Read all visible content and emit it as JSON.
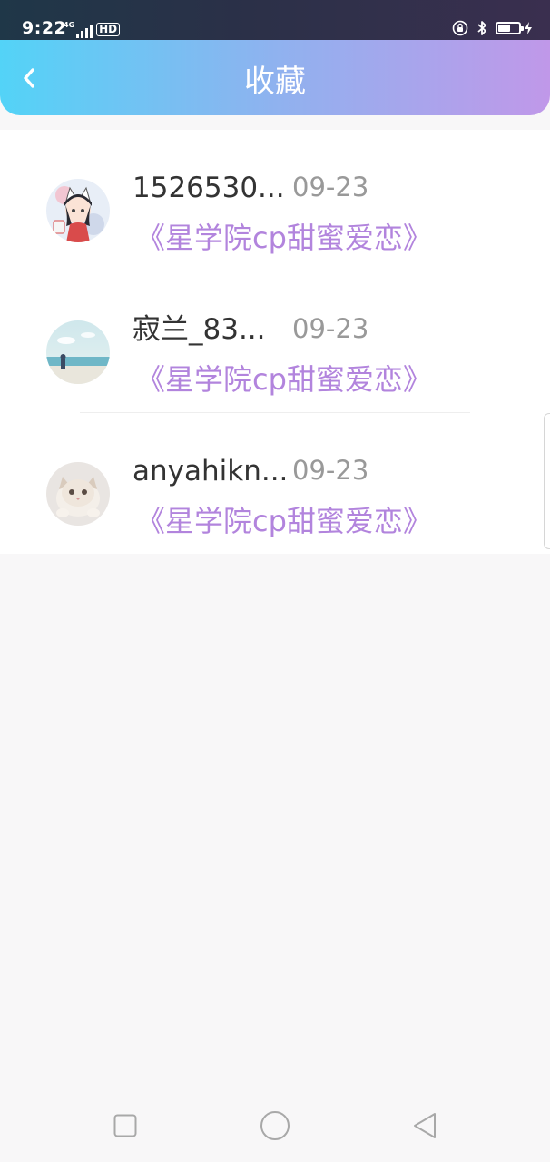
{
  "status_bar": {
    "time": "9:22",
    "network_type": "4G",
    "hd_label": "HD",
    "battery_level": 0.6
  },
  "header": {
    "back_icon": "chevron-left-icon",
    "title": "收藏"
  },
  "favorites": [
    {
      "user_name": "1526530...",
      "date": "09-23",
      "work_title": "《星学院cp甜蜜爱恋》",
      "avatar": "anime-girl-avatar"
    },
    {
      "user_name": "寂兰_83...",
      "date": "09-23",
      "work_title": "《星学院cp甜蜜爱恋》",
      "avatar": "beach-scene-avatar"
    },
    {
      "user_name": "anyahikn...",
      "date": "09-23",
      "work_title": "《星学院cp甜蜜爱恋》",
      "avatar": "kitten-avatar"
    }
  ],
  "nav_bar": {
    "buttons": [
      "square-recents-icon",
      "circle-home-icon",
      "triangle-back-icon"
    ]
  },
  "colors": {
    "header_gradient_start": "#53d3f7",
    "header_gradient_end": "#c098e9",
    "work_title": "#b284dd",
    "date": "#999999",
    "name": "#333333"
  }
}
